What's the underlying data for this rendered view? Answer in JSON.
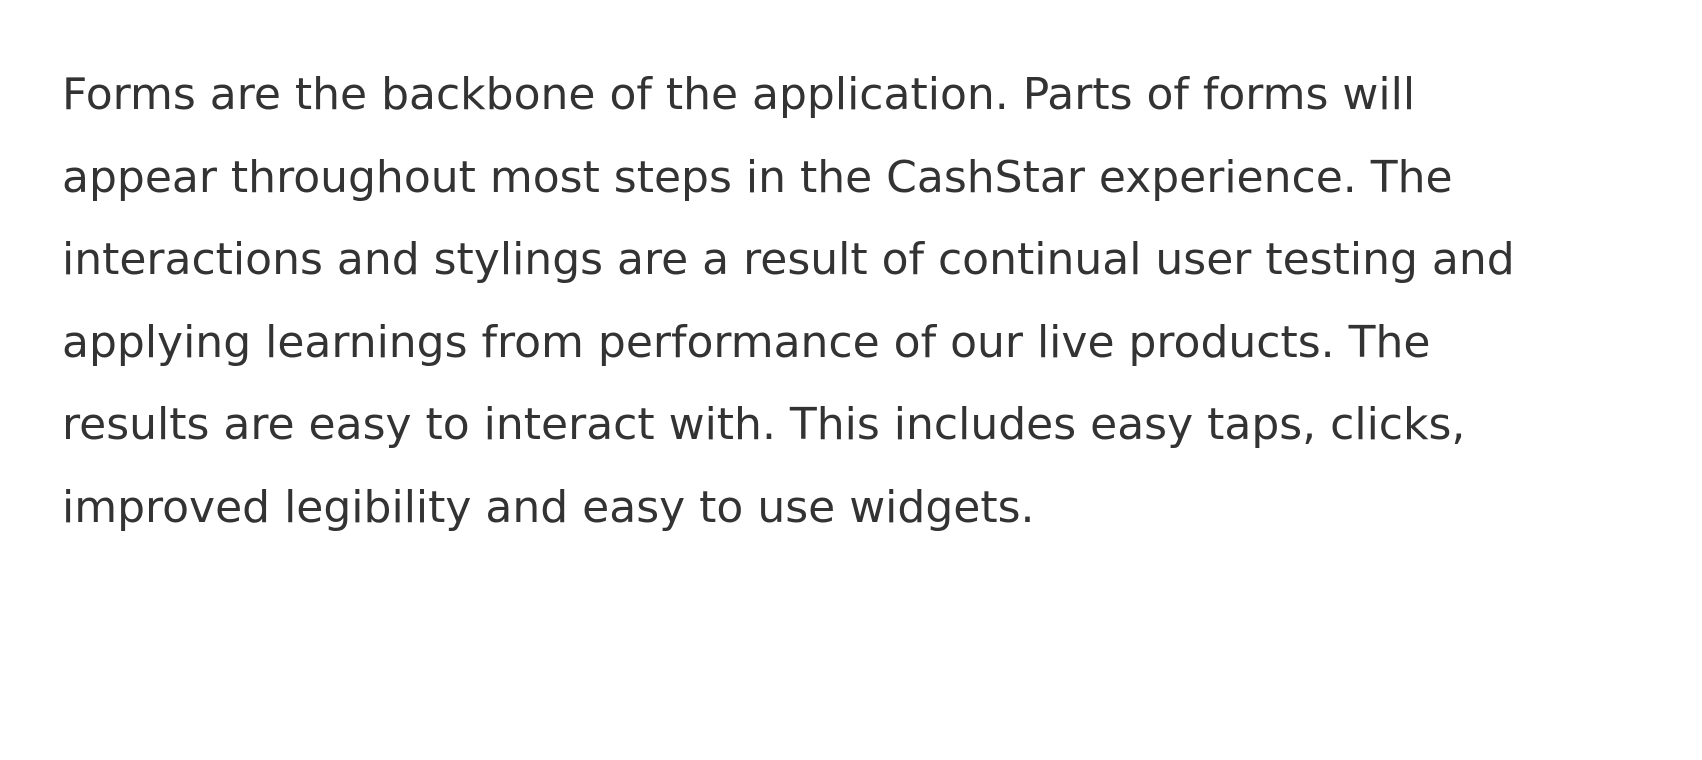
{
  "paragraph": {
    "lines": [
      "Forms are the backbone of the application. Parts of forms will",
      "appear throughout most steps in the CashStar experience. The",
      "interactions and stylings are a result of continual user testing and",
      "applying learnings from performance of our live products. The",
      "results are easy to interact with. This includes easy taps, clicks,",
      "improved legibility and easy to use widgets."
    ]
  },
  "colors": {
    "text": "#333333",
    "background": "#ffffff"
  }
}
